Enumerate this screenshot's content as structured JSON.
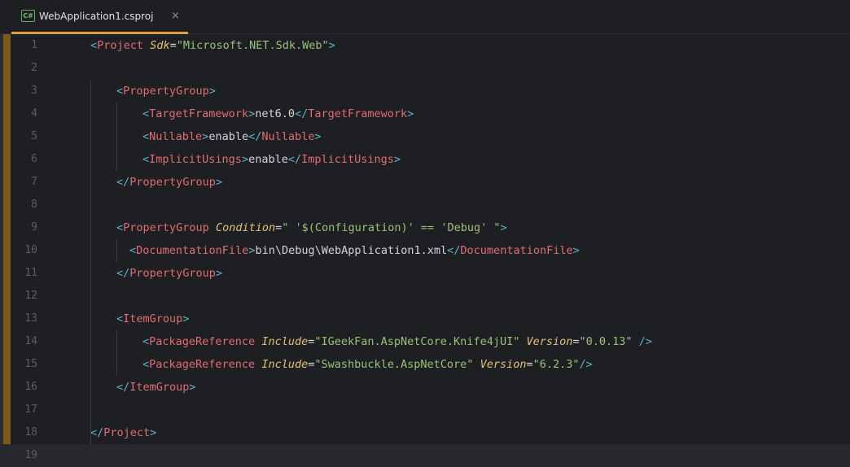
{
  "tab": {
    "icon_label": "C#",
    "title": "WebApplication1.csproj",
    "close_glyph": "×"
  },
  "colors": {
    "background": "#1e1f22",
    "tag": "#e06c75",
    "bracket": "#5ab4c8",
    "attribute": "#e5c07b",
    "string": "#98c379",
    "text": "#d5d5d5",
    "active_tab_underline": "#e59b33",
    "vcs_change_bar": "#7a5a17"
  },
  "editor": {
    "current_line": 19,
    "lines": [
      {
        "num": "1",
        "indent": 0,
        "tokens": [
          [
            "bracket",
            "<"
          ],
          [
            "tag",
            "Project"
          ],
          [
            "txt",
            " "
          ],
          [
            "attr",
            "Sdk"
          ],
          [
            "txt",
            "="
          ],
          [
            "str",
            "\"Microsoft.NET.Sdk.Web\""
          ],
          [
            "bracket",
            ">"
          ]
        ]
      },
      {
        "num": "2",
        "indent": 0,
        "tokens": []
      },
      {
        "num": "3",
        "indent": 1,
        "tokens": [
          [
            "bracket",
            "<"
          ],
          [
            "tag",
            "PropertyGroup"
          ],
          [
            "bracket",
            ">"
          ]
        ]
      },
      {
        "num": "4",
        "indent": 2,
        "tokens": [
          [
            "bracket",
            "<"
          ],
          [
            "tag",
            "TargetFramework"
          ],
          [
            "bracket",
            ">"
          ],
          [
            "txt",
            "net6.0"
          ],
          [
            "bracket",
            "</"
          ],
          [
            "tag",
            "TargetFramework"
          ],
          [
            "bracket",
            ">"
          ]
        ]
      },
      {
        "num": "5",
        "indent": 2,
        "tokens": [
          [
            "bracket",
            "<"
          ],
          [
            "tag",
            "Nullable"
          ],
          [
            "bracket",
            ">"
          ],
          [
            "txt",
            "enable"
          ],
          [
            "bracket",
            "</"
          ],
          [
            "tag",
            "Nullable"
          ],
          [
            "bracket",
            ">"
          ]
        ]
      },
      {
        "num": "6",
        "indent": 2,
        "tokens": [
          [
            "bracket",
            "<"
          ],
          [
            "tag",
            "ImplicitUsings"
          ],
          [
            "bracket",
            ">"
          ],
          [
            "txt",
            "enable"
          ],
          [
            "bracket",
            "</"
          ],
          [
            "tag",
            "ImplicitUsings"
          ],
          [
            "bracket",
            ">"
          ]
        ]
      },
      {
        "num": "7",
        "indent": 1,
        "tokens": [
          [
            "bracket",
            "</"
          ],
          [
            "tag",
            "PropertyGroup"
          ],
          [
            "bracket",
            ">"
          ]
        ]
      },
      {
        "num": "8",
        "indent": 0,
        "tokens": []
      },
      {
        "num": "9",
        "indent": 1,
        "tokens": [
          [
            "bracket",
            "<"
          ],
          [
            "tag",
            "PropertyGroup"
          ],
          [
            "txt",
            " "
          ],
          [
            "attr",
            "Condition"
          ],
          [
            "txt",
            "="
          ],
          [
            "str",
            "\" '$(Configuration)' == 'Debug' \""
          ],
          [
            "bracket",
            ">"
          ]
        ]
      },
      {
        "num": "10",
        "indent": 1.5,
        "tokens": [
          [
            "bracket",
            "<"
          ],
          [
            "tag",
            "DocumentationFile"
          ],
          [
            "bracket",
            ">"
          ],
          [
            "txt",
            "bin\\Debug\\WebApplication1.xml"
          ],
          [
            "bracket",
            "</"
          ],
          [
            "tag",
            "DocumentationFile"
          ],
          [
            "bracket",
            ">"
          ]
        ]
      },
      {
        "num": "11",
        "indent": 1,
        "tokens": [
          [
            "bracket",
            "</"
          ],
          [
            "tag",
            "PropertyGroup"
          ],
          [
            "bracket",
            ">"
          ]
        ]
      },
      {
        "num": "12",
        "indent": 0,
        "tokens": []
      },
      {
        "num": "13",
        "indent": 1,
        "tokens": [
          [
            "bracket",
            "<"
          ],
          [
            "tag",
            "ItemGroup"
          ],
          [
            "bracket",
            ">"
          ]
        ]
      },
      {
        "num": "14",
        "indent": 2,
        "tokens": [
          [
            "bracket",
            "<"
          ],
          [
            "tag",
            "PackageReference"
          ],
          [
            "txt",
            " "
          ],
          [
            "attr",
            "Include"
          ],
          [
            "txt",
            "="
          ],
          [
            "str",
            "\"IGeekFan.AspNetCore.Knife4jUI\""
          ],
          [
            "txt",
            " "
          ],
          [
            "attr",
            "Version"
          ],
          [
            "txt",
            "="
          ],
          [
            "str",
            "\"0.0.13\""
          ],
          [
            "txt",
            " "
          ],
          [
            "bracket",
            "/>"
          ]
        ]
      },
      {
        "num": "15",
        "indent": 2,
        "tokens": [
          [
            "bracket",
            "<"
          ],
          [
            "tag",
            "PackageReference"
          ],
          [
            "txt",
            " "
          ],
          [
            "attr",
            "Include"
          ],
          [
            "txt",
            "="
          ],
          [
            "str",
            "\"Swashbuckle.AspNetCore\""
          ],
          [
            "txt",
            " "
          ],
          [
            "attr",
            "Version"
          ],
          [
            "txt",
            "="
          ],
          [
            "str",
            "\"6.2.3\""
          ],
          [
            "bracket",
            "/>"
          ]
        ]
      },
      {
        "num": "16",
        "indent": 1,
        "tokens": [
          [
            "bracket",
            "</"
          ],
          [
            "tag",
            "ItemGroup"
          ],
          [
            "bracket",
            ">"
          ]
        ]
      },
      {
        "num": "17",
        "indent": 0,
        "tokens": []
      },
      {
        "num": "18",
        "indent": 0,
        "tokens": [
          [
            "bracket",
            "</"
          ],
          [
            "tag",
            "Project"
          ],
          [
            "bracket",
            ">"
          ]
        ]
      },
      {
        "num": "19",
        "indent": 0,
        "tokens": []
      }
    ]
  }
}
